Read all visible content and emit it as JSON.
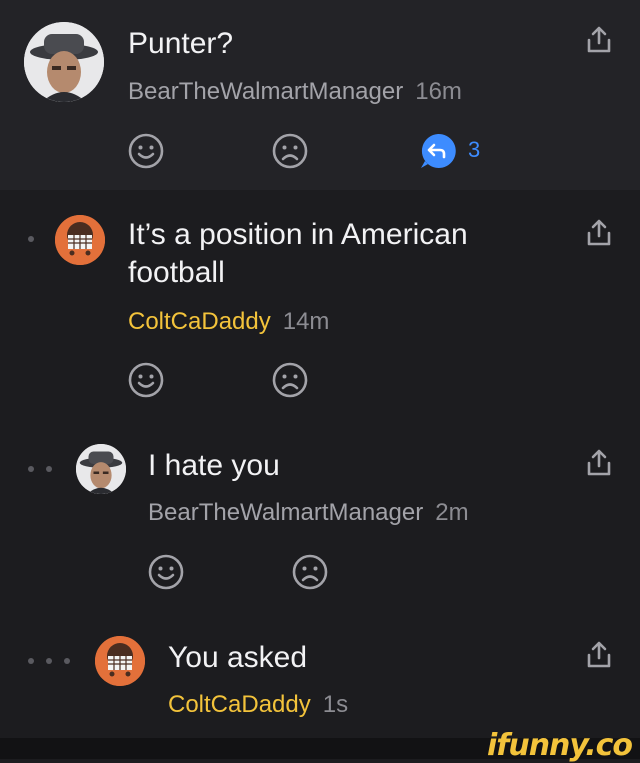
{
  "comments": [
    {
      "text": "Punter?",
      "username": "BearTheWalmartManager",
      "time": "16m",
      "replies": "3"
    },
    {
      "text_line1": "It’s a position in American",
      "text_line2": "football",
      "username": "ColtCaDaddy",
      "time": "14m"
    },
    {
      "text": "I hate you",
      "username": "BearTheWalmartManager",
      "time": "2m"
    },
    {
      "text": "You asked",
      "username": "ColtCaDaddy",
      "time": "1s"
    }
  ],
  "watermark": "ifunny.co",
  "colors": {
    "accent_blue": "#3d8cff",
    "username_gold": "#f3c33b",
    "username_gray": "#a3a3a9",
    "background": "#1c1c1f"
  },
  "icons": [
    "smile-icon",
    "frown-icon",
    "reply-icon",
    "share-icon"
  ]
}
